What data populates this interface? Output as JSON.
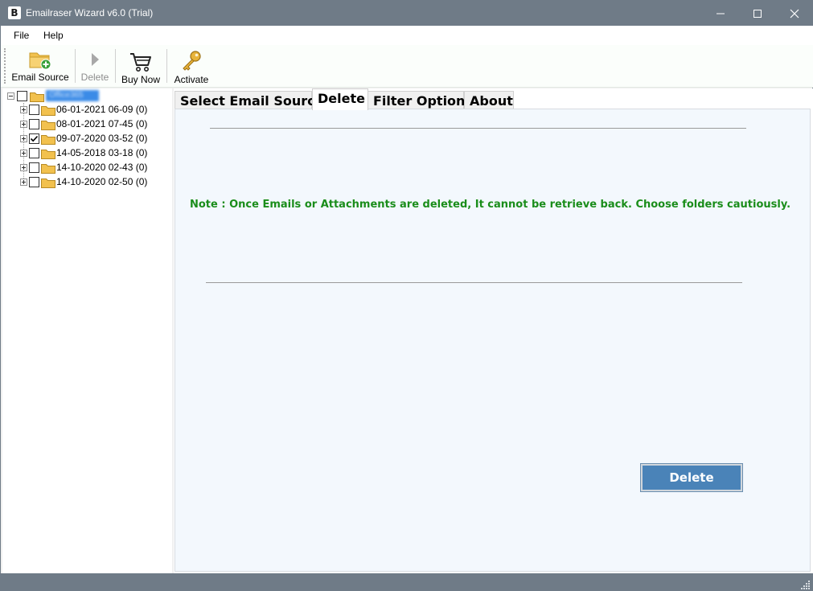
{
  "window": {
    "title": "Emailraser Wizard v6.0 (Trial)",
    "app_icon_letter": "B"
  },
  "menu": {
    "file": "File",
    "help": "Help"
  },
  "toolbar": {
    "email_source": "Email Source",
    "delete": "Delete",
    "buy_now": "Buy Now",
    "activate": "Activate"
  },
  "tree": {
    "root_label": "Office365",
    "items": [
      {
        "label": "06-01-2021 06-09 (0)",
        "checked": false
      },
      {
        "label": "08-01-2021 07-45 (0)",
        "checked": false
      },
      {
        "label": "09-07-2020 03-52 (0)",
        "checked": true
      },
      {
        "label": "14-05-2018 03-18  (0)",
        "checked": false
      },
      {
        "label": "14-10-2020 02-43 (0)",
        "checked": false
      },
      {
        "label": "14-10-2020 02-50 (0)",
        "checked": false
      }
    ]
  },
  "tabs": [
    {
      "label": "Select Email Source",
      "active": false
    },
    {
      "label": "Delete",
      "active": true
    },
    {
      "label": "Filter Options",
      "active": false
    },
    {
      "label": "About",
      "active": false
    }
  ],
  "delete_panel": {
    "note": "Note : Once Emails or Attachments are deleted, It cannot be retrieve back. Choose folders cautiously.",
    "delete_button": "Delete"
  },
  "colors": {
    "titlebar": "#6f7b87",
    "note_text": "#1a8d1a",
    "delete_button": "#4a83b8"
  }
}
